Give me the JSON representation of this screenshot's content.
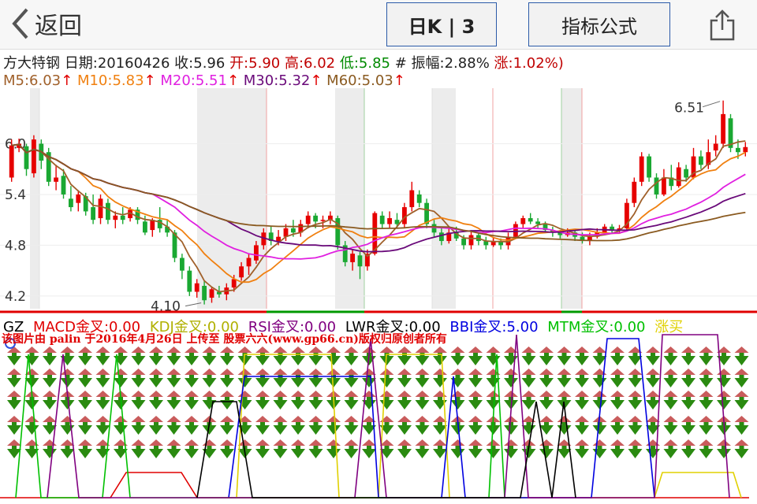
{
  "nav": {
    "back_label": "返回",
    "kline_button": "日K | 3",
    "formula_button": "指标公式"
  },
  "quote": {
    "name": "方大特钢",
    "date_label": "日期:",
    "date": "20160426",
    "close_label": "收:",
    "close": "5.96",
    "open_label": "开:",
    "open": "5.90",
    "high_label": "高:",
    "high": "6.02",
    "low_label": "低:",
    "low": "5.85",
    "amp_label": "# 振幅:",
    "amplitude": "2.88%",
    "chg_label": "涨:",
    "change": "1.02%)"
  },
  "ma": [
    {
      "label": "M5:6.03",
      "color": "#a0602a"
    },
    {
      "label": "M10:5.83",
      "color": "#f08010"
    },
    {
      "label": "M20:5.51",
      "color": "#e020e0"
    },
    {
      "label": "M30:5.32",
      "color": "#6a0a7a"
    },
    {
      "label": "M60:5.03",
      "color": "#8a5a20"
    }
  ],
  "price_axis": [
    "6.0",
    "5.4",
    "4.8",
    "4.2"
  ],
  "annotations": {
    "high": "6.51",
    "low": "4.10"
  },
  "indicators": [
    {
      "label": "GZ",
      "color": "#000000"
    },
    {
      "label": "MACD金叉:0.00",
      "color": "#e00000"
    },
    {
      "label": "KDJ金叉:0.00",
      "color": "#b0b000"
    },
    {
      "label": "RSI金叉:0.00",
      "color": "#800080"
    },
    {
      "label": "LWR金叉:0.00",
      "color": "#000000"
    },
    {
      "label": "BBI金叉:5.00",
      "color": "#0000e0"
    },
    {
      "label": "MTM金叉:0.00",
      "color": "#00c000"
    },
    {
      "label": "涨买",
      "color": "#e0d000"
    }
  ],
  "watermark": "该图片由 palin 于2016年4月26日 上传至 股票六六(www.gp66.cn)版权归原创者所有",
  "chart_data": {
    "type": "candlestick",
    "price_axis_ticks": [
      6.0,
      5.4,
      4.8,
      4.2
    ],
    "period_high": 6.51,
    "period_low": 4.1,
    "candles": [
      [
        5.6,
        5.98,
        6.05,
        5.55
      ],
      [
        5.95,
        6.0,
        6.06,
        5.9
      ],
      [
        5.97,
        5.7,
        6.0,
        5.62
      ],
      [
        5.65,
        6.05,
        6.1,
        5.6
      ],
      [
        6.0,
        5.8,
        6.05,
        5.7
      ],
      [
        5.9,
        5.55,
        5.95,
        5.5
      ],
      [
        5.55,
        5.6,
        5.75,
        5.45
      ],
      [
        5.62,
        5.4,
        5.7,
        5.35
      ],
      [
        5.35,
        5.25,
        5.5,
        5.2
      ],
      [
        5.3,
        5.4,
        5.45,
        5.2
      ],
      [
        5.38,
        5.2,
        5.42,
        5.15
      ],
      [
        5.25,
        5.1,
        5.4,
        5.05
      ],
      [
        5.12,
        5.35,
        5.4,
        5.05
      ],
      [
        5.3,
        5.1,
        5.35,
        5.05
      ],
      [
        5.1,
        5.15,
        5.2,
        5.0
      ],
      [
        5.15,
        5.1,
        5.25,
        5.05
      ],
      [
        5.12,
        5.22,
        5.25,
        5.08
      ],
      [
        5.22,
        5.1,
        5.25,
        5.05
      ],
      [
        5.08,
        4.95,
        5.15,
        4.92
      ],
      [
        4.98,
        5.1,
        5.12,
        4.9
      ],
      [
        5.1,
        5.0,
        5.25,
        4.95
      ],
      [
        5.02,
        4.95,
        5.1,
        4.9
      ],
      [
        4.95,
        4.65,
        4.98,
        4.6
      ],
      [
        4.65,
        4.5,
        4.7,
        4.4
      ],
      [
        4.5,
        4.25,
        4.55,
        4.2
      ],
      [
        4.25,
        4.35,
        4.4,
        4.18
      ],
      [
        4.32,
        4.15,
        4.38,
        4.1
      ],
      [
        4.18,
        4.28,
        4.3,
        4.12
      ],
      [
        4.25,
        4.22,
        4.32,
        4.18
      ],
      [
        4.22,
        4.3,
        4.35,
        4.15
      ],
      [
        4.3,
        4.4,
        4.45,
        4.25
      ],
      [
        4.42,
        4.55,
        4.6,
        4.38
      ],
      [
        4.55,
        4.65,
        4.7,
        4.45
      ],
      [
        4.62,
        4.8,
        4.85,
        4.58
      ],
      [
        4.8,
        4.95,
        5.0,
        4.75
      ],
      [
        4.95,
        4.85,
        5.02,
        4.8
      ],
      [
        4.85,
        4.9,
        4.98,
        4.8
      ],
      [
        4.9,
        5.0,
        5.05,
        4.85
      ],
      [
        5.0,
        4.95,
        5.1,
        4.9
      ],
      [
        4.95,
        5.05,
        5.1,
        4.9
      ],
      [
        5.05,
        5.15,
        5.2,
        5.0
      ],
      [
        5.15,
        5.08,
        5.18,
        5.0
      ],
      [
        5.1,
        5.1,
        5.15,
        5.0
      ],
      [
        5.1,
        5.15,
        5.2,
        5.05
      ],
      [
        5.12,
        4.8,
        5.15,
        4.75
      ],
      [
        4.8,
        4.6,
        4.85,
        4.55
      ],
      [
        4.6,
        4.7,
        4.75,
        4.5
      ],
      [
        4.68,
        4.55,
        4.72,
        4.4
      ],
      [
        4.55,
        4.7,
        4.75,
        4.5
      ],
      [
        4.7,
        5.18,
        5.2,
        4.68
      ],
      [
        5.15,
        5.05,
        5.2,
        5.0
      ],
      [
        5.05,
        5.12,
        5.2,
        5.0
      ],
      [
        5.1,
        5.05,
        5.18,
        5.0
      ],
      [
        5.05,
        5.25,
        5.3,
        5.0
      ],
      [
        5.25,
        5.45,
        5.55,
        5.2
      ],
      [
        5.4,
        5.3,
        5.45,
        5.25
      ],
      [
        5.3,
        5.05,
        5.35,
        5.0
      ],
      [
        5.05,
        4.95,
        5.1,
        4.9
      ],
      [
        4.95,
        4.85,
        5.0,
        4.8
      ],
      [
        4.85,
        4.95,
        5.0,
        4.82
      ],
      [
        4.95,
        4.88,
        5.02,
        4.85
      ],
      [
        4.88,
        4.8,
        4.92,
        4.75
      ],
      [
        4.8,
        4.92,
        4.98,
        4.75
      ],
      [
        4.92,
        4.85,
        4.95,
        4.8
      ],
      [
        4.85,
        4.8,
        4.9,
        4.75
      ],
      [
        4.8,
        4.85,
        4.9,
        4.78
      ],
      [
        4.85,
        4.8,
        4.88,
        4.75
      ],
      [
        4.8,
        4.9,
        4.95,
        4.75
      ],
      [
        4.9,
        5.05,
        5.08,
        4.88
      ],
      [
        5.05,
        5.12,
        5.15,
        5.0
      ],
      [
        5.12,
        5.08,
        5.18,
        5.05
      ],
      [
        5.08,
        5.05,
        5.12,
        5.0
      ],
      [
        5.05,
        4.98,
        5.08,
        4.95
      ],
      [
        4.98,
        4.95,
        5.02,
        4.9
      ],
      [
        4.95,
        4.92,
        4.98,
        4.88
      ],
      [
        4.92,
        4.95,
        5.0,
        4.9
      ],
      [
        4.95,
        4.9,
        4.98,
        4.85
      ],
      [
        4.9,
        4.85,
        4.95,
        4.82
      ],
      [
        4.85,
        4.9,
        4.95,
        4.8
      ],
      [
        4.9,
        4.95,
        5.0,
        4.88
      ],
      [
        4.95,
        5.02,
        5.05,
        4.92
      ],
      [
        5.02,
        4.98,
        5.05,
        4.94
      ],
      [
        4.98,
        5.0,
        5.04,
        4.95
      ],
      [
        5.0,
        5.3,
        5.35,
        4.98
      ],
      [
        5.3,
        5.55,
        5.6,
        5.25
      ],
      [
        5.55,
        5.85,
        5.9,
        5.5
      ],
      [
        5.85,
        5.6,
        5.88,
        5.55
      ],
      [
        5.6,
        5.4,
        5.65,
        5.35
      ],
      [
        5.4,
        5.6,
        5.7,
        5.38
      ],
      [
        5.6,
        5.5,
        5.75,
        5.45
      ],
      [
        5.5,
        5.72,
        5.78,
        5.48
      ],
      [
        5.7,
        5.6,
        5.75,
        5.55
      ],
      [
        5.6,
        5.85,
        5.95,
        5.58
      ],
      [
        5.85,
        5.75,
        5.92,
        5.7
      ],
      [
        5.75,
        5.9,
        6.05,
        5.7
      ],
      [
        5.92,
        6.0,
        6.1,
        5.85
      ],
      [
        6.0,
        6.35,
        6.51,
        5.95
      ],
      [
        6.3,
        5.95,
        6.35,
        5.9
      ],
      [
        5.95,
        5.9,
        6.05,
        5.82
      ],
      [
        5.9,
        5.96,
        6.02,
        5.85
      ]
    ]
  }
}
